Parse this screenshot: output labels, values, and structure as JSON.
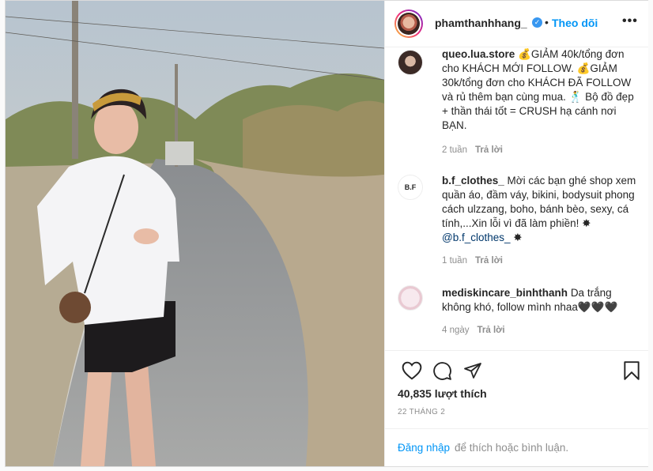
{
  "post": {
    "username": "phamthanhhang_",
    "separator": "•",
    "follow_label": "Theo dõi",
    "more_label": "•••"
  },
  "comments": [
    {
      "username": "queo.lua.store",
      "text": "💰GIẢM 40k/tổng đơn cho KHÁCH MỚI FOLLOW. 💰GIẢM 30k/tổng đơn cho KHÁCH ĐÃ FOLLOW và rủ thêm bạn cùng mua. 🕺 Bộ đồ đẹp + thần thái tốt = CRUSH hạ cánh nơi BẠN.",
      "time": "2 tuần",
      "reply_label": "Trả lời"
    },
    {
      "username": "b.f_clothes_",
      "text": "Mời các bạn ghé shop xem quần áo, đầm váy, bikini, bodysuit phong cách ulzzang, boho, bánh bèo, sexy, cá tính,...Xin lỗi vì đã làm phiền!",
      "star": "✸",
      "mention": "@b.f_clothes_",
      "time": "1 tuần",
      "reply_label": "Trả lời",
      "avatar_text": "B.F"
    },
    {
      "username": "mediskincare_binhthanh",
      "text": "Da trắng không khó, follow mình nhaa🖤🖤🖤",
      "time": "4 ngày",
      "reply_label": "Trả lời"
    }
  ],
  "stats": {
    "likes": "40,835 lượt thích",
    "date": "22 THÁNG 2"
  },
  "login": {
    "link": "Đăng nhập",
    "rest": "để thích hoặc bình luận."
  },
  "icons": {
    "like": "heart-icon",
    "comment": "comment-icon",
    "share": "share-icon",
    "save": "bookmark-icon",
    "verified": "verified-badge-icon"
  },
  "colors": {
    "link": "#0095f6",
    "verified": "#3897f0",
    "muted": "#8e8e8e",
    "text": "#262626"
  }
}
